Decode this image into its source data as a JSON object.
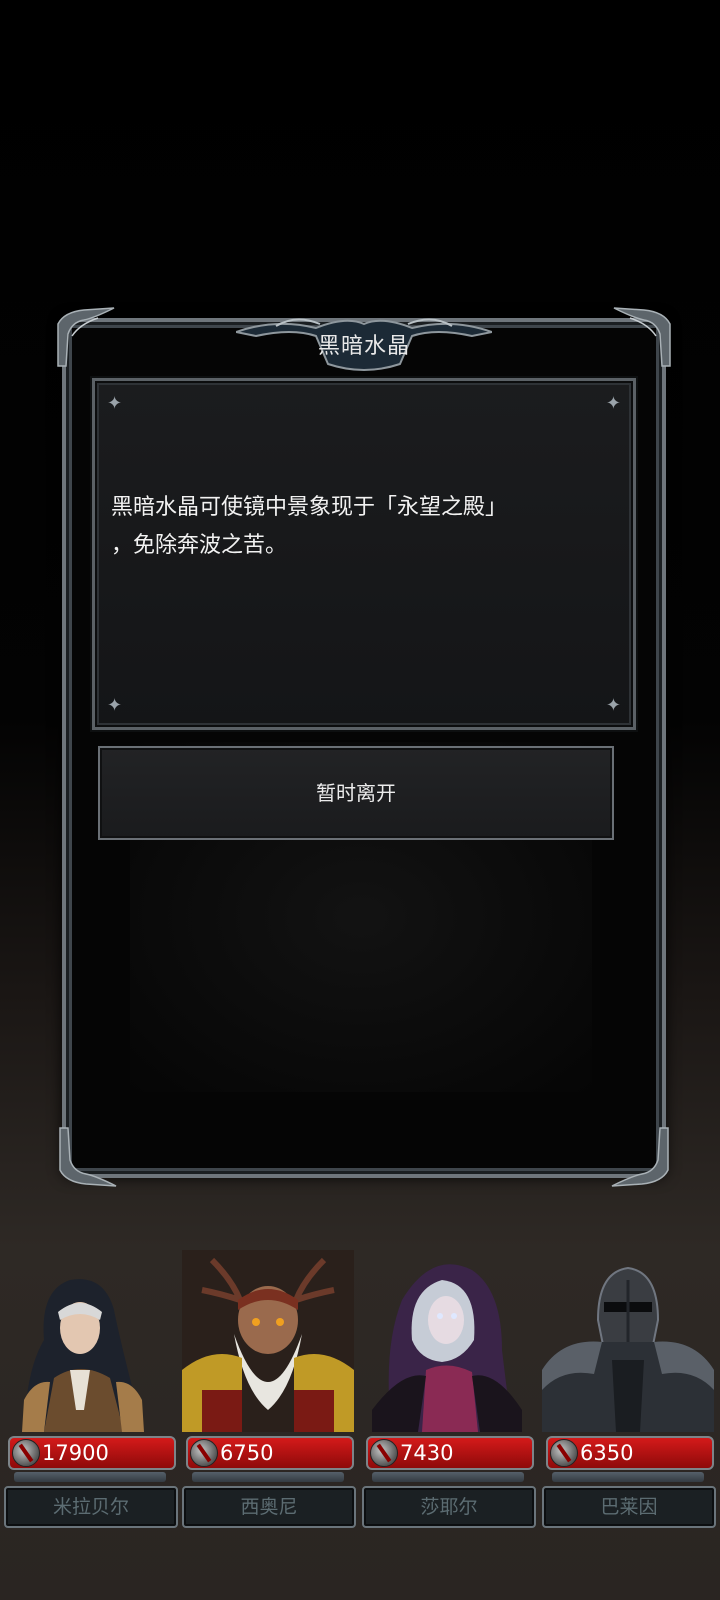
{
  "dialog": {
    "title": "黑暗水晶",
    "body_lines": [
      "黑暗水晶可使镜中景象现于「永望之殿」",
      "，免除奔波之苦。"
    ],
    "leave_button": "暂时离开"
  },
  "party": [
    {
      "name": "米拉贝尔",
      "hp": "17900"
    },
    {
      "name": "西奥尼",
      "hp": "6750"
    },
    {
      "name": "莎耶尔",
      "hp": "7430"
    },
    {
      "name": "巴莱因",
      "hp": "6350"
    }
  ],
  "colors": {
    "hp_bar": "#c81414",
    "frame": "#6f767c",
    "nameplate_text": "#5c6c72"
  }
}
